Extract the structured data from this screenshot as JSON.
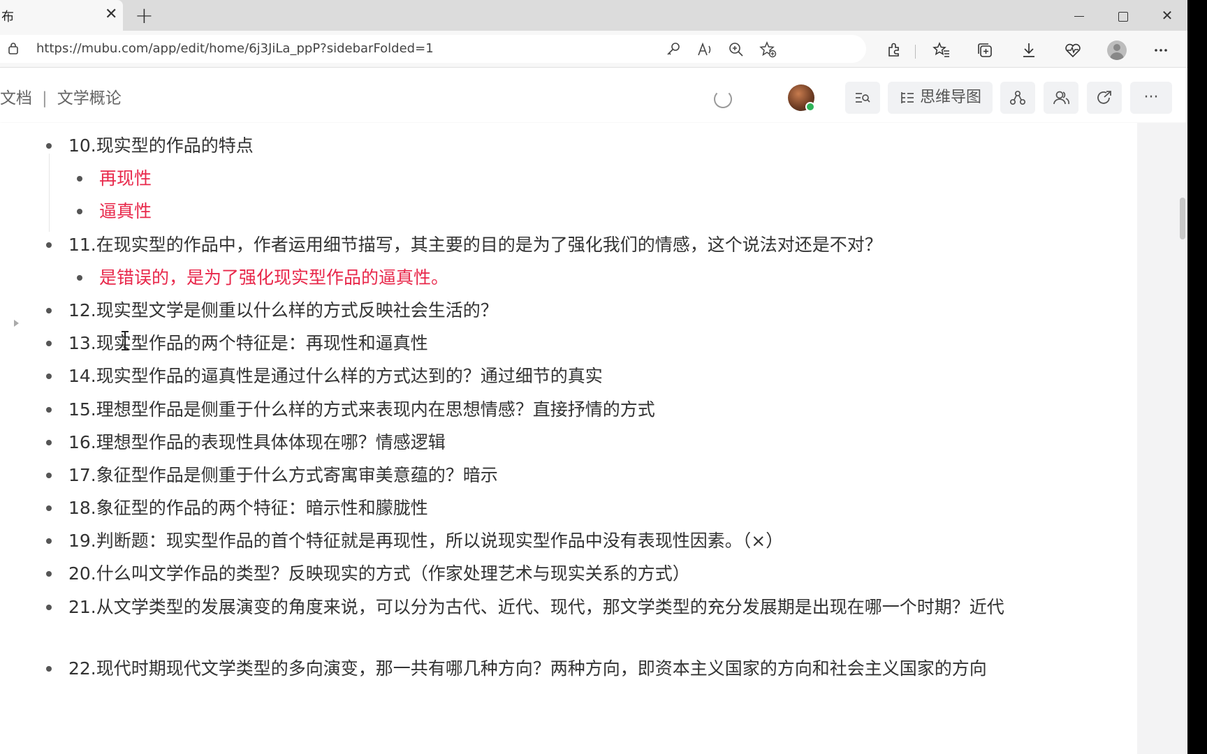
{
  "browser": {
    "tab_title": "布",
    "tab_close": "✕",
    "new_tab": "+",
    "url": "https://mubu.com/app/edit/home/6j3JiLa_ppP?sidebarFolded=1",
    "close_icon": "✕"
  },
  "app": {
    "breadcrumb_left": "文档",
    "breadcrumb_sep": "|",
    "breadcrumb_current": "文学概论",
    "mindmap_label": "思维导图",
    "more_label": "···"
  },
  "colors": {
    "accent_red": "#e8284b",
    "text": "#333333"
  },
  "outline": [
    {
      "text": "10.现实型的作品的特点",
      "level": 0
    },
    {
      "text": "再现性",
      "level": 1,
      "highlight": true
    },
    {
      "text": "逼真性",
      "level": 1,
      "highlight": true
    },
    {
      "text": "11.在现实型的作品中，作者运用细节描写，其主要的目的是为了强化我们的情感，这个说法对还是不对？",
      "level": 0
    },
    {
      "text": "是错误的，是为了强化现实型作品的逼真性。",
      "level": 1,
      "highlight": true
    },
    {
      "text": "12.现实型文学是侧重以什么样的方式反映社会生活的？",
      "level": 0,
      "collapsed": true
    },
    {
      "text": "13.现实型作品的两个特征是：再现性和逼真性",
      "level": 0
    },
    {
      "text": "14.现实型作品的逼真性是通过什么样的方式达到的？通过细节的真实",
      "level": 0
    },
    {
      "text": "15.理想型作品是侧重于什么样的方式来表现内在思想情感？直接抒情的方式",
      "level": 0
    },
    {
      "text": "16.理想型作品的表现性具体体现在哪？情感逻辑",
      "level": 0
    },
    {
      "text": "17.象征型作品是侧重于什么方式寄寓审美意蕴的？暗示",
      "level": 0
    },
    {
      "text": "18.象征型的作品的两个特征：暗示性和朦胧性",
      "level": 0
    },
    {
      "text": "19.判断题：现实型作品的首个特征就是再现性，所以说现实型作品中没有表现性因素。（×）",
      "level": 0
    },
    {
      "text": "20.什么叫文学作品的类型？反映现实的方式（作家处理艺术与现实关系的方式）",
      "level": 0
    },
    {
      "text": "21.从文学类型的发展演变的角度来说，可以分为古代、近代、现代，那文学类型的充分发展期是出现在哪一个时期？近代",
      "level": 0
    },
    {
      "text": "22.现代时期现代文学类型的多向演变，那一共有哪几种方向？两种方向，即资本主义国家的方向和社会主义国家的方向",
      "level": 0
    }
  ]
}
